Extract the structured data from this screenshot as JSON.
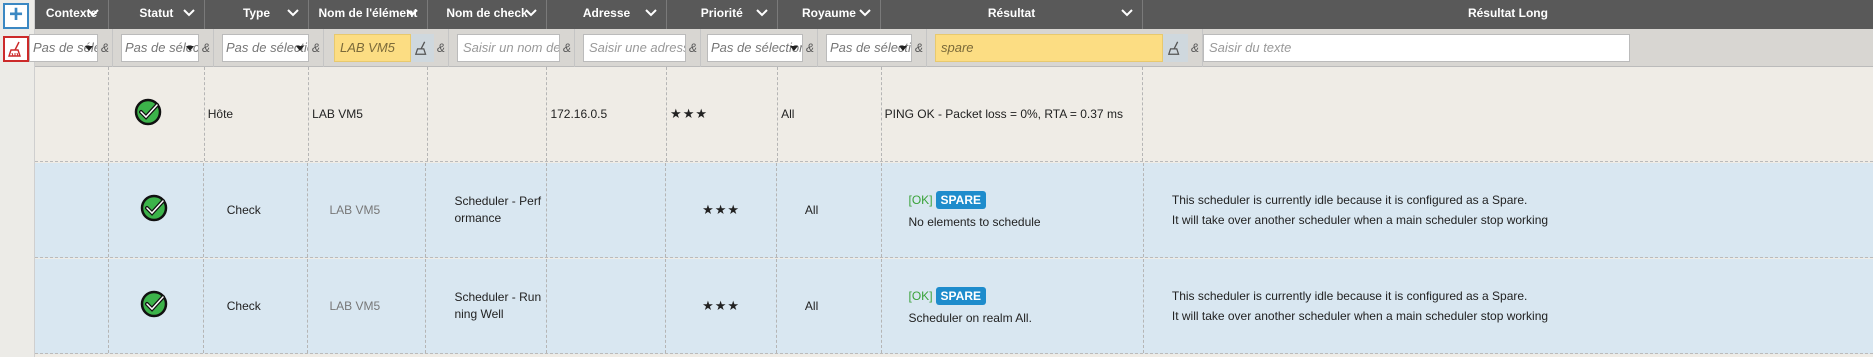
{
  "columns": [
    {
      "label": "Contexte"
    },
    {
      "label": "Statut"
    },
    {
      "label": "Type"
    },
    {
      "label": "Nom de l'élément"
    },
    {
      "label": "Nom de check"
    },
    {
      "label": "Adresse"
    },
    {
      "label": "Priorité"
    },
    {
      "label": "Royaume"
    },
    {
      "label": "Résultat"
    },
    {
      "label": "Résultat Long"
    }
  ],
  "toolbar": {
    "add_label": "+"
  },
  "filters": {
    "contexte_select": "Pas de sélection",
    "statut_select": "Pas de sélection",
    "type_select": "Pas de sélection",
    "element_value": "LAB VM5",
    "check_placeholder": "Saisir un nom de check",
    "adresse_placeholder": "Saisir une adresse",
    "priorite_select": "Pas de sélection",
    "royaume_select": "Pas de sélection",
    "resultat_value": "spare",
    "resultat_long_placeholder": "Saisir du texte",
    "amp": "&"
  },
  "rows": [
    {
      "type": "Hôte",
      "element": "LAB VM5",
      "check": "",
      "address": "172.16.0.5",
      "priority": "★★★",
      "realm": "All",
      "result": "PING OK - Packet loss = 0%, RTA = 0.37 ms"
    },
    {
      "type": "Check",
      "element": "LAB VM5",
      "check": "Scheduler - Performance",
      "address": "",
      "priority": "★★★",
      "realm": "All",
      "result_state": "[OK]",
      "result_badge": "SPARE",
      "result_text": "No elements to schedule",
      "long_line1": "This scheduler is currently idle because it is configured as a Spare.",
      "long_line2": "It will take over another scheduler when a main scheduler stop working"
    },
    {
      "type": "Check",
      "element": "LAB VM5",
      "check": "Scheduler - Running Well",
      "address": "",
      "priority": "★★★",
      "realm": "All",
      "result_state": "[OK]",
      "result_badge": "SPARE",
      "result_text": "Scheduler on realm All.",
      "long_line1": "This scheduler is currently idle because it is configured as a Spare.",
      "long_line2": "It will take over another scheduler when a main scheduler stop working"
    }
  ],
  "colors": {
    "header_bg": "#595959",
    "check_row_bg": "#d9e7f1",
    "active_filter": "#fcdd83",
    "spare_badge": "#1e8ccc",
    "ok_green": "#3aa33a"
  }
}
